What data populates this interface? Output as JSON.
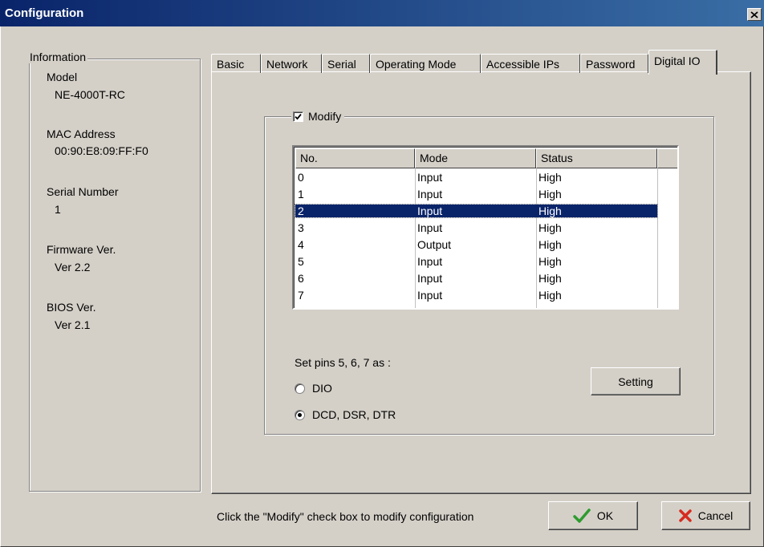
{
  "window": {
    "title": "Configuration"
  },
  "info": {
    "legend": "Information",
    "model_label": "Model",
    "model_value": "NE-4000T-RC",
    "mac_label": "MAC Address",
    "mac_value": "00:90:E8:09:FF:F0",
    "serial_label": "Serial Number",
    "serial_value": "1",
    "firmware_label": "Firmware Ver.",
    "firmware_value": "Ver 2.2",
    "bios_label": "BIOS Ver.",
    "bios_value": "Ver 2.1"
  },
  "tabs": [
    {
      "label": "Basic"
    },
    {
      "label": "Network"
    },
    {
      "label": "Serial"
    },
    {
      "label": "Operating Mode"
    },
    {
      "label": "Accessible IPs"
    },
    {
      "label": "Password"
    },
    {
      "label": "Digital IO",
      "active": true
    }
  ],
  "digital_io": {
    "modify_label": "Modify",
    "modify_checked": true,
    "columns": [
      "No.",
      "Mode",
      "Status"
    ],
    "rows": [
      {
        "no": "0",
        "mode": "Input",
        "status": "High"
      },
      {
        "no": "1",
        "mode": "Input",
        "status": "High"
      },
      {
        "no": "2",
        "mode": "Input",
        "status": "High",
        "selected": true
      },
      {
        "no": "3",
        "mode": "Input",
        "status": "High"
      },
      {
        "no": "4",
        "mode": "Output",
        "status": "High"
      },
      {
        "no": "5",
        "mode": "Input",
        "status": "High"
      },
      {
        "no": "6",
        "mode": "Input",
        "status": "High"
      },
      {
        "no": "7",
        "mode": "Input",
        "status": "High"
      }
    ],
    "set_pins_label": "Set pins 5, 6, 7 as :",
    "option_dio": "DIO",
    "option_dcd": "DCD, DSR, DTR",
    "selected_option": "DCD, DSR, DTR",
    "setting_button": "Setting"
  },
  "footer": {
    "hint": "Click the \"Modify\" check box to modify configuration",
    "ok_label": "OK",
    "cancel_label": "Cancel"
  },
  "colors": {
    "title_bar": "#0a246a",
    "selection": "#0a246a",
    "ok_check": "#2e9b2e",
    "cancel_x": "#d62b1f"
  }
}
